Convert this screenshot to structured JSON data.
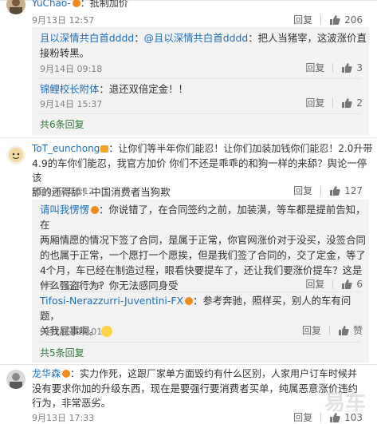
{
  "icons": {
    "like": "thumb-up-icon",
    "avatar": "avatar-image",
    "badge": "vip-badge-icon",
    "emoji": "emoji-icon"
  },
  "reply_label": "回复",
  "c1": {
    "name": "YuChao-",
    "text": "：抵制加价",
    "time": "9月13日 12:57",
    "likes": "206"
  },
  "c1_replies": [
    {
      "name": "且以深情共白首dddd",
      "mention": "@且以深情共白首dddd",
      "text": "：把人当猪宰，这波涨价直接粉转黑。",
      "time": "9月14日 09:18",
      "likes": "3"
    },
    {
      "name": "锦鲤校长附体",
      "text": "：退还双倍定金！！",
      "time": "9月14日 15:37",
      "likes": "2"
    }
  ],
  "c1_more": "共6条回复",
  "c2": {
    "name": "ToT_eunchong",
    "text_lines": [
      "：让你们等半年你们能忍！让你们加装加钱你们能忍！2.0升带",
      "4.9的车你们能忍，我官方加价 你们不还是乖乖的和狗一样的来舔？舆论一停该",
      "舔的还得舔！中国消费者当狗欺"
    ],
    "time": "9月13日 11:12",
    "likes": "127"
  },
  "c2_replies": [
    {
      "name": "请叫我愣愣",
      "text_lines": [
        "：你说错了，在合同签约之前，加装潢，等车都是提前告知，在",
        "两厢情愿的情况下签了合同，是属于正常，你官网涨价对于没买，没签合同",
        "的也属于正常，一个愿打一个愿挨，但是我们签了合同的，交了定金，等了",
        "4个月，车已经在制造过程，眼看快要提车了，还让我们要涨价提车？这是",
        "什么强盗行为？你无法感同身受"
      ],
      "time": "9月15日 08:09",
      "likes": "6"
    },
    {
      "name": "Tifosi-Nerazzurri-Juventini-FX",
      "text_lines": [
        "：参考奔驰，照样买，别人的车有问题，",
        "关我屁事啊。"
      ],
      "time": "9月14日 10:01",
      "likes": "赞"
    }
  ],
  "c2_more": "共5条回复",
  "c3": {
    "name": "龙华森",
    "text_lines": [
      "：实力作死，这跟厂家单方面毁约有什么区别，人家用户订车时候并",
      "没有要求你加的升级东西，现在是要强行要消费者买单，纯属恶意涨价违约",
      "行为，非常恶劣。"
    ],
    "time": "9月13日 17:33",
    "likes": "103"
  },
  "watermark": "易车"
}
